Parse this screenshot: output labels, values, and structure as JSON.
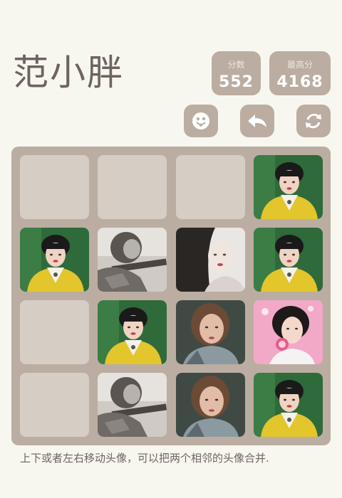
{
  "app": {
    "title": "范小胖"
  },
  "scores": {
    "current_label": "分数",
    "current_value": "552",
    "best_label": "最高分",
    "best_value": "4168"
  },
  "controls": [
    {
      "name": "face-button",
      "icon": "smiley-face-icon"
    },
    {
      "name": "undo-button",
      "icon": "undo-arrow-icon"
    },
    {
      "name": "restart-button",
      "icon": "refresh-icon"
    }
  ],
  "board": {
    "rows": 4,
    "cols": 4,
    "grid": [
      [
        "empty",
        "empty",
        "empty",
        "yellow-dress"
      ],
      [
        "yellow-dress",
        "bw-rifle",
        "bw-portrait",
        "yellow-dress"
      ],
      [
        "empty",
        "yellow-dress",
        "brown-hair",
        "pink-lollipop"
      ],
      [
        "empty",
        "bw-rifle",
        "brown-hair",
        "yellow-dress"
      ]
    ]
  },
  "hint": "上下或者左右移动头像，可以把两个相邻的头像合并.",
  "colors": {
    "background": "#f8f7ef",
    "board": "#bbada2",
    "empty_cell": "#d6cdc4",
    "title": "#6e645c"
  }
}
